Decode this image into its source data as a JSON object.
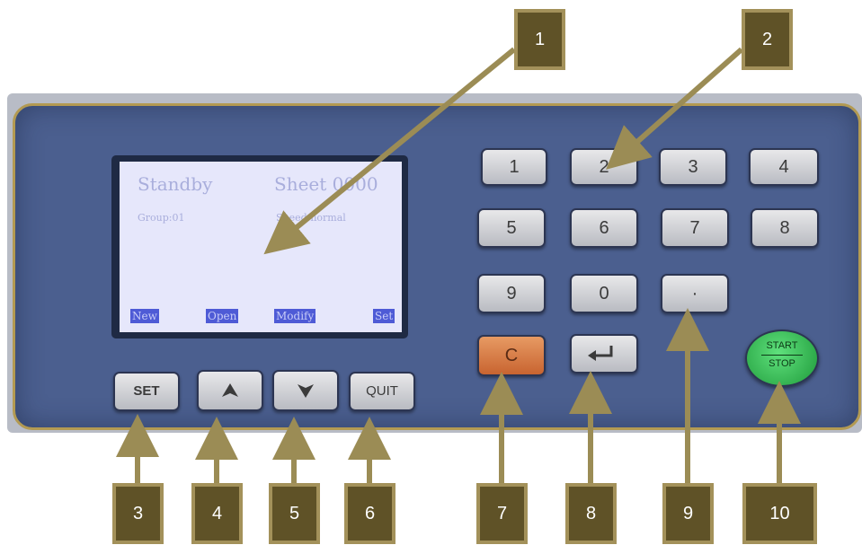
{
  "lcd": {
    "status": "Standby",
    "sheet": "Sheet 0000",
    "group": "Group:01",
    "speed": "Speed:normal",
    "softkeys": [
      "New",
      "Open",
      "Modify",
      "Set"
    ]
  },
  "keypad": {
    "digits": [
      "1",
      "2",
      "3",
      "4",
      "5",
      "6",
      "7",
      "8",
      "9",
      "0",
      "·"
    ],
    "clear": "C",
    "enter_icon": "enter-arrow-icon"
  },
  "nav_buttons": {
    "set": "SET",
    "up_icon": "up-arrow-icon",
    "down_icon": "down-arrow-icon",
    "quit": "QUIT"
  },
  "start_stop": {
    "start": "START",
    "stop": "STOP"
  },
  "callouts": [
    "1",
    "2",
    "3",
    "4",
    "5",
    "6",
    "7",
    "8",
    "9",
    "10"
  ],
  "colors": {
    "panel": "#4b5f8f",
    "callout_fill": "#5f5227",
    "callout_border": "#a3915a",
    "arrow": "#9b8c55",
    "lcd_bg": "#e6e7fb",
    "clear_key": "#d9773f",
    "start_button": "#3cc25a"
  }
}
